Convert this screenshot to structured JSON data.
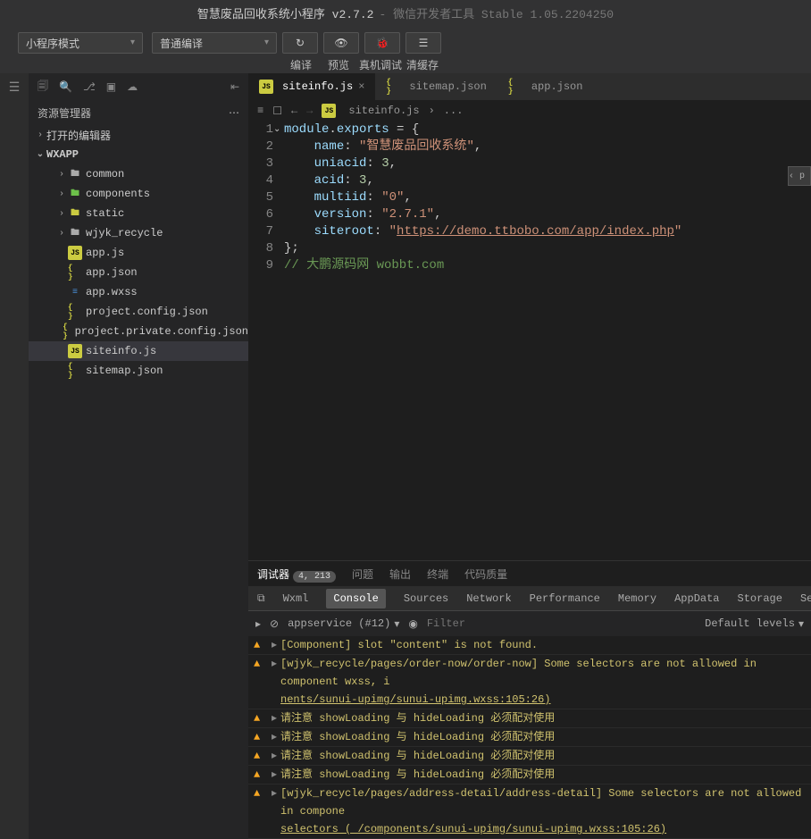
{
  "title": {
    "main": "智慧废品回收系统小程序 v2.7.2",
    "sub": " - 微信开发者工具 Stable 1.05.2204250"
  },
  "toolbar": {
    "mode": "小程序模式",
    "compile_mode": "普通编译",
    "btn1": "编译",
    "btn2": "预览",
    "btn3": "真机调试",
    "btn4": "清缓存"
  },
  "sidebar": {
    "title": "资源管理器",
    "sections": {
      "opened": "打开的编辑器",
      "project": "WXAPP"
    },
    "tree": [
      {
        "type": "folder",
        "name": "common",
        "depth": 1
      },
      {
        "type": "folder",
        "name": "components",
        "depth": 1,
        "icon": "comp"
      },
      {
        "type": "folder",
        "name": "static",
        "depth": 1,
        "icon": "static"
      },
      {
        "type": "folder",
        "name": "wjyk_recycle",
        "depth": 1
      },
      {
        "type": "file",
        "name": "app.js",
        "depth": 1,
        "icon": "js"
      },
      {
        "type": "file",
        "name": "app.json",
        "depth": 1,
        "icon": "json"
      },
      {
        "type": "file",
        "name": "app.wxss",
        "depth": 1,
        "icon": "wxss"
      },
      {
        "type": "file",
        "name": "project.config.json",
        "depth": 1,
        "icon": "json"
      },
      {
        "type": "file",
        "name": "project.private.config.json",
        "depth": 1,
        "icon": "json"
      },
      {
        "type": "file",
        "name": "siteinfo.js",
        "depth": 1,
        "icon": "js",
        "selected": true
      },
      {
        "type": "file",
        "name": "sitemap.json",
        "depth": 1,
        "icon": "json"
      }
    ]
  },
  "tabs": [
    {
      "name": "siteinfo.js",
      "icon": "js",
      "active": true,
      "close": true
    },
    {
      "name": "sitemap.json",
      "icon": "json"
    },
    {
      "name": "app.json",
      "icon": "json"
    }
  ],
  "breadcrumb": {
    "file": "siteinfo.js",
    "sep": "›",
    "tail": "..."
  },
  "code": {
    "name_key": "name",
    "name_val": "智慧废品回收系统",
    "uniacid_key": "uniacid",
    "uniacid_val": "3",
    "acid_key": "acid",
    "acid_val": "3",
    "multiid_key": "multiid",
    "multiid_val": "0",
    "version_key": "version",
    "version_val": "2.7.1",
    "siteroot_key": "siteroot",
    "siteroot_val": "https://demo.ttbobo.com/app/index.php",
    "module": "module",
    "exports": "exports",
    "comment": "// 大鹏源码网 wobbt.com"
  },
  "panel": {
    "tabs1": {
      "debugger": "调试器",
      "count": "4, 213",
      "issues": "问题",
      "output": "输出",
      "terminal": "终端",
      "quality": "代码质量"
    },
    "tabs2": [
      "Wxml",
      "Console",
      "Sources",
      "Network",
      "Performance",
      "Memory",
      "AppData",
      "Storage",
      "Secur"
    ],
    "active_tab2": "Console",
    "console": {
      "context": "appservice (#12)",
      "filter_ph": "Filter",
      "levels": "Default levels",
      "msgs": [
        "[Component] slot \"content\" is not found.",
        "[wjyk_recycle/pages/order-now/order-now] Some selectors are not allowed in component wxss, i\nnents/sunui-upimg/sunui-upimg.wxss:105:26)",
        "请注意 showLoading 与 hideLoading 必须配对使用",
        "请注意 showLoading 与 hideLoading 必须配对使用",
        "请注意 showLoading 与 hideLoading 必须配对使用",
        "请注意 showLoading 与 hideLoading 必须配对使用",
        "[wjyk_recycle/pages/address-detail/address-detail] Some selectors are not allowed in compone\nselectors ( /components/sunui-upimg/sunui-upimg.wxss:105:26)"
      ]
    }
  }
}
